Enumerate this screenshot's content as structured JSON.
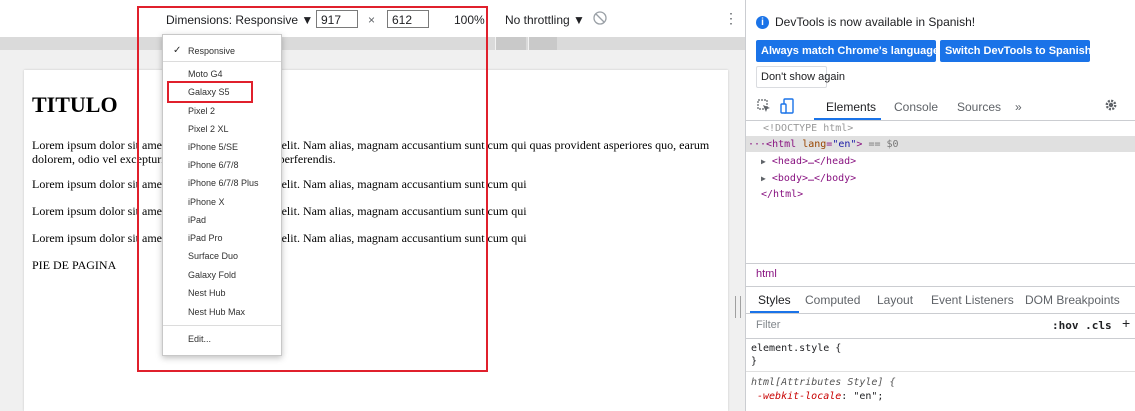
{
  "toolbar": {
    "dimensions_label": "Dimensions: Responsive ▼",
    "width_value": "917",
    "times": "×",
    "height_value": "612",
    "zoom": "100%",
    "throttling": "No throttling ▼",
    "more": "⋮"
  },
  "device_menu": {
    "selected": "Responsive",
    "check": "✓",
    "devices": [
      "Moto G4",
      "Galaxy S5",
      "Pixel 2",
      "Pixel 2 XL",
      "iPhone 5/SE",
      "iPhone 6/7/8",
      "iPhone 6/7/8 Plus",
      "iPhone X",
      "iPad",
      "iPad Pro",
      "Surface Duo",
      "Galaxy Fold",
      "Nest Hub",
      "Nest Hub Max"
    ],
    "edit": "Edit..."
  },
  "page": {
    "title": "TITULO",
    "para_1": "Lorem ipsum dolor sit amet consectetur adipisicing elit. Nam alias, magnam accusantium sunt cum qui quas provident asperiores quo, earum dolorem, odio vel excepturi voluptate debitis dolor perferendis.",
    "para_2": "Lorem ipsum dolor sit amet consectetur adipisicing elit. Nam alias, magnam accusantium sunt cum qui",
    "para_3": "Lorem ipsum dolor sit amet consectetur adipisicing elit. Nam alias, magnam accusantium sunt cum qui",
    "para_4": "Lorem ipsum dolor sit amet consectetur adipisicing elit. Nam alias, magnam accusantium sunt cum qui",
    "footer": "PIE DE PAGINA"
  },
  "devtools": {
    "infobar": {
      "icon": "i",
      "message": "DevTools is now available in Spanish!",
      "match_button": "Always match Chrome's language",
      "switch_button": "Switch DevTools to Spanish",
      "dont_show": "Don't show again"
    },
    "tabs": {
      "elements": "Elements",
      "console": "Console",
      "sources": "Sources",
      "more": "»"
    },
    "dom": {
      "doctype": "<!DOCTYPE html>",
      "html_open_prefix": "···<html ",
      "html_attr_name": "lang",
      "html_attr_eq": "=",
      "html_attr_val": "\"en\"",
      "html_open_suffix": ">",
      "selected_marker": " == $0",
      "head": "<head>…</head>",
      "body": "<body>…</body>",
      "html_close": "</html>",
      "triangle": "▶"
    },
    "breadcrumb": "html",
    "styles_tabs": {
      "styles": "Styles",
      "computed": "Computed",
      "layout": "Layout",
      "event_listeners": "Event Listeners",
      "dom_breakpoints": "DOM Breakpoints"
    },
    "filter_placeholder": "Filter",
    "hov_cls": ":hov .cls",
    "plus": "+",
    "css": {
      "element_style": "element.style {",
      "close_brace": "}",
      "html_attr_style": "html[Attributes Style] {",
      "locale_prop": "-webkit-locale",
      "locale_colon": ": ",
      "locale_val": "\"en\";"
    }
  },
  "colors": {
    "highlight": "#e0202c",
    "accent": "#1a73e8"
  }
}
